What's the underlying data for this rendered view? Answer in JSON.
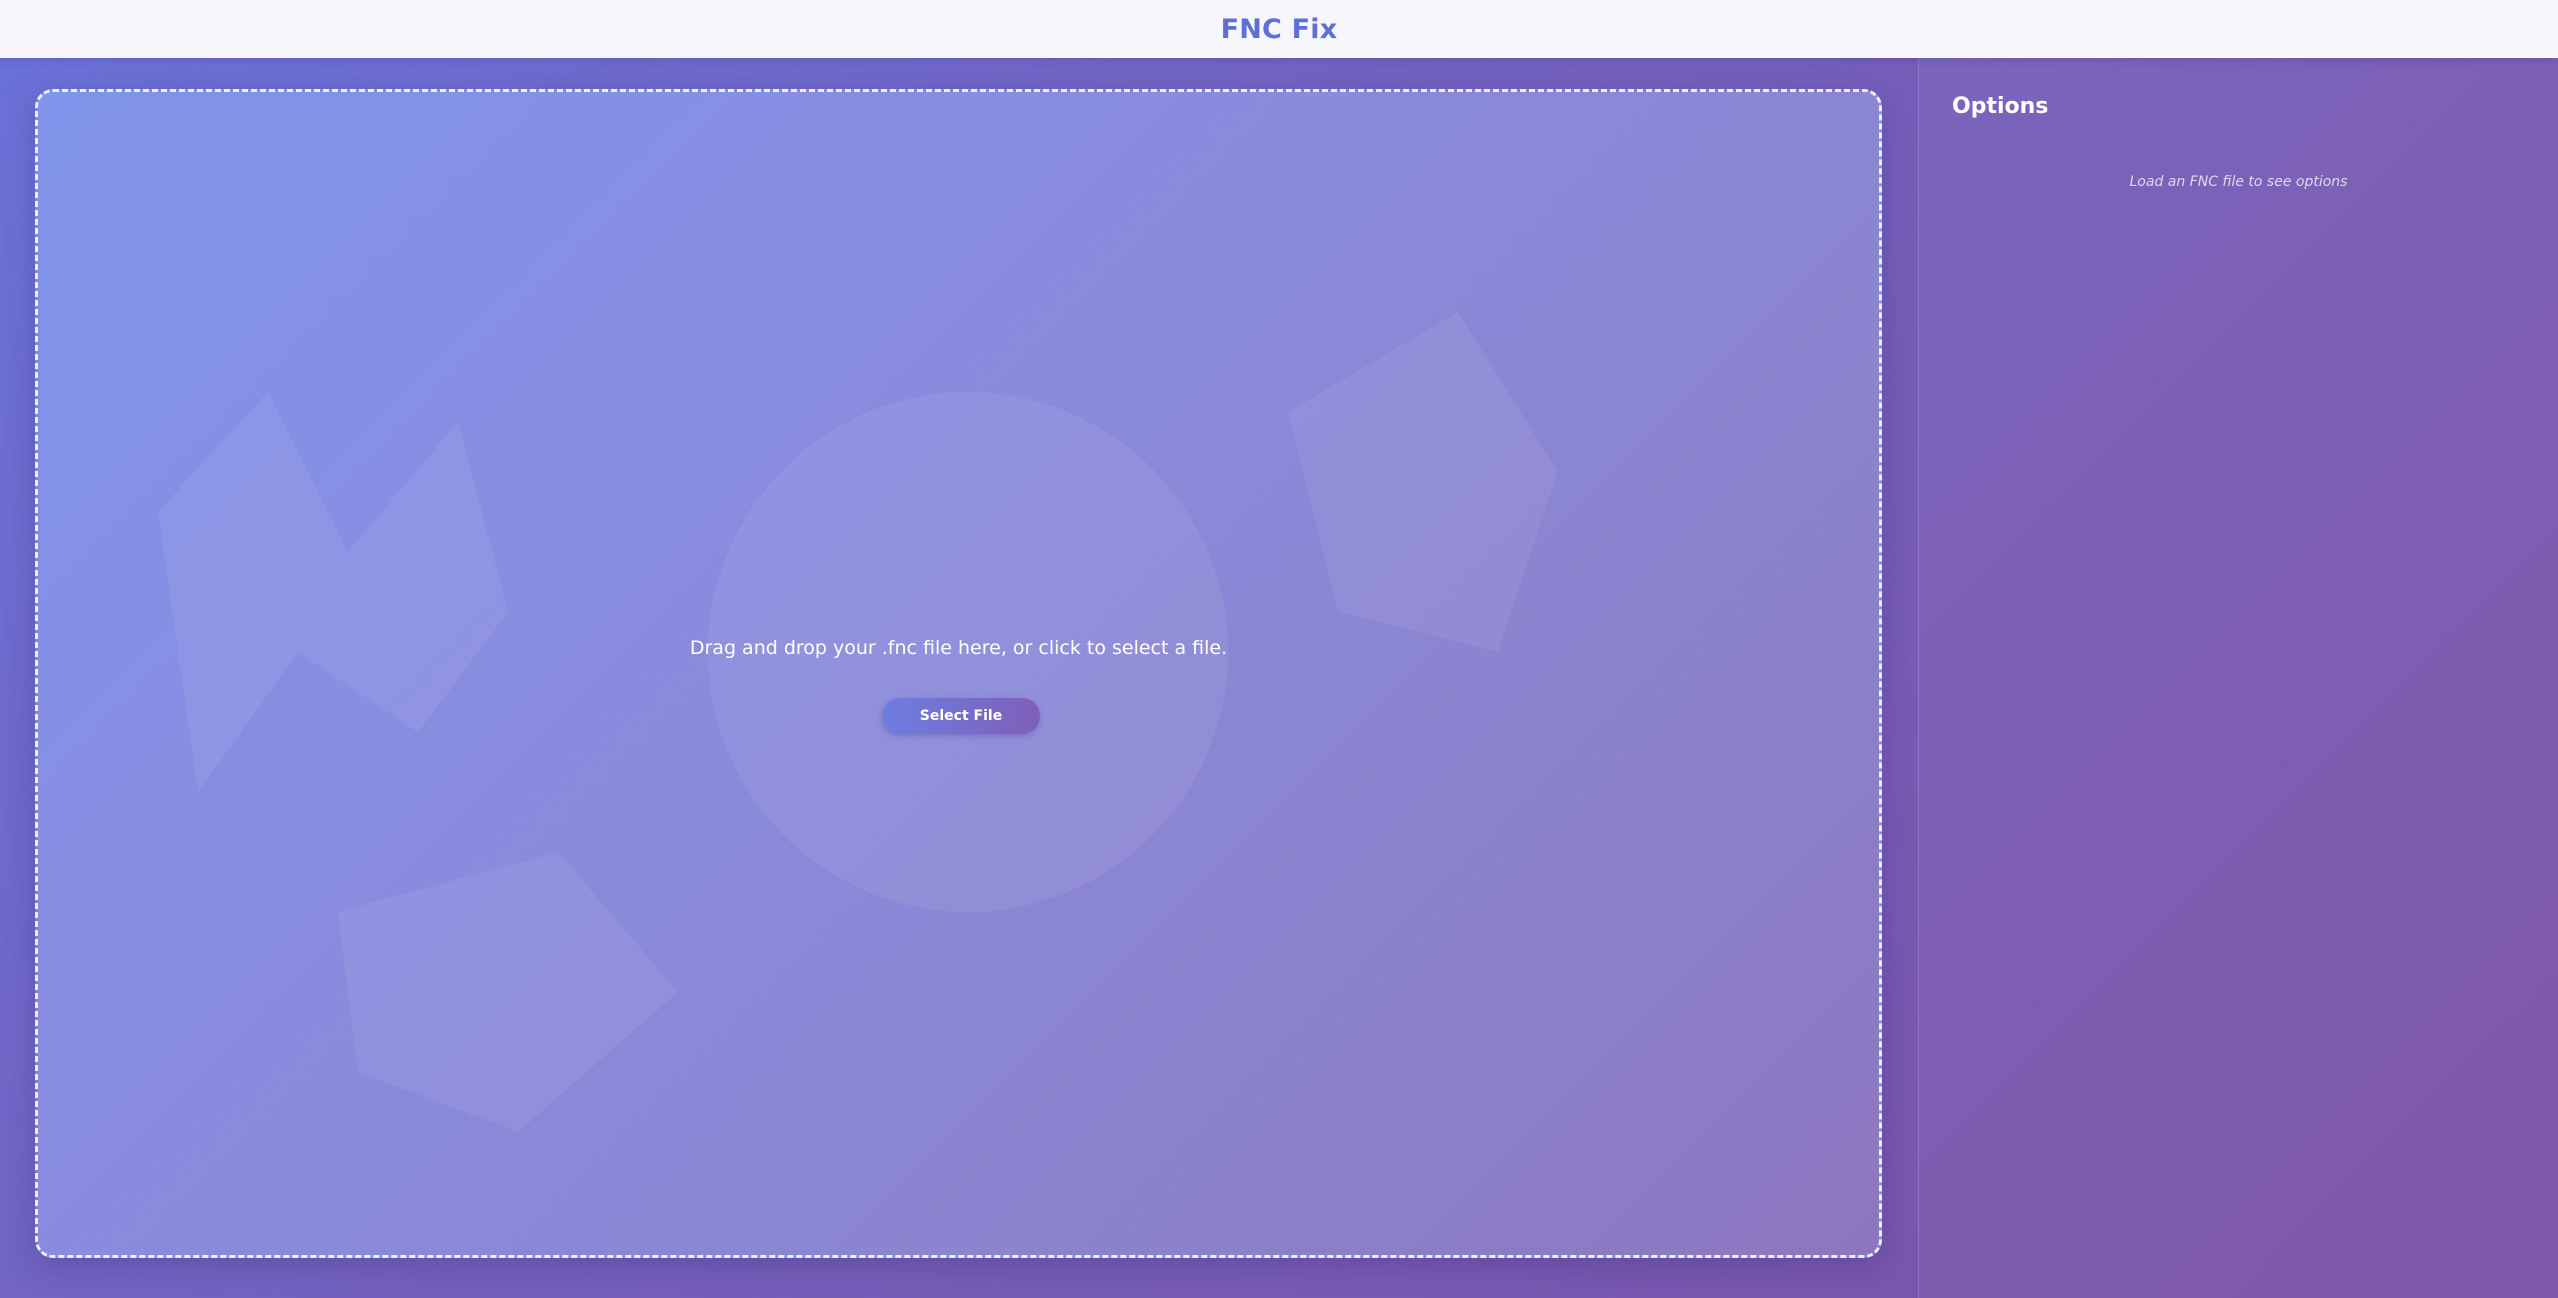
{
  "header": {
    "title": "FNC Fix"
  },
  "dropzone": {
    "instruction": "Drag and drop your .fnc file here, or click to select a file.",
    "select_button_label": "Select File",
    "icon": "upload-file-icon"
  },
  "sidebar": {
    "title": "Options",
    "empty_message": "Load an FNC file to see options"
  },
  "colors": {
    "title_accent": "#5f6fd6",
    "background_start": "#6a72d8",
    "background_end": "#7b52a6",
    "button_start": "#6d7ee0",
    "button_end": "#7e5fb8"
  }
}
